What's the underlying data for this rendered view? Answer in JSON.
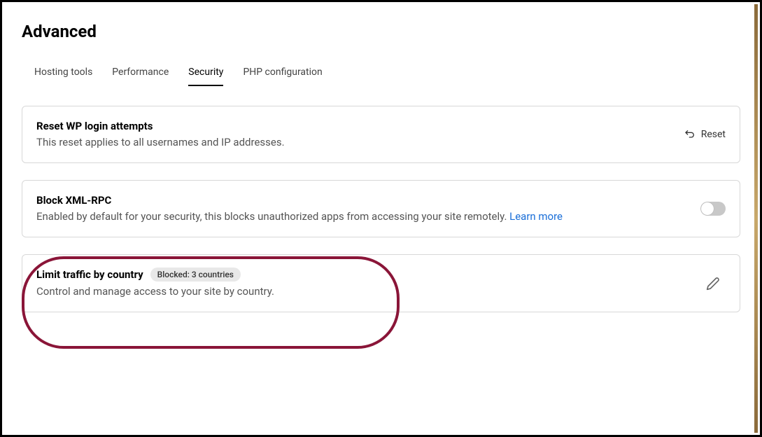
{
  "page_title": "Advanced",
  "tabs": [
    {
      "label": "Hosting tools",
      "active": false
    },
    {
      "label": "Performance",
      "active": false
    },
    {
      "label": "Security",
      "active": true
    },
    {
      "label": "PHP configuration",
      "active": false
    }
  ],
  "cards": {
    "reset_wp": {
      "title": "Reset WP login attempts",
      "desc": "This reset applies to all usernames and IP addresses.",
      "action_label": "Reset"
    },
    "block_xmlrpc": {
      "title": "Block XML-RPC",
      "desc_prefix": "Enabled by default for your security, this blocks unauthorized apps from accessing your site remotely. ",
      "learn_more": "Learn more",
      "toggle_on": false
    },
    "limit_traffic": {
      "title": "Limit traffic by country",
      "badge": "Blocked: 3 countries",
      "desc": "Control and manage access to your site by country."
    }
  }
}
